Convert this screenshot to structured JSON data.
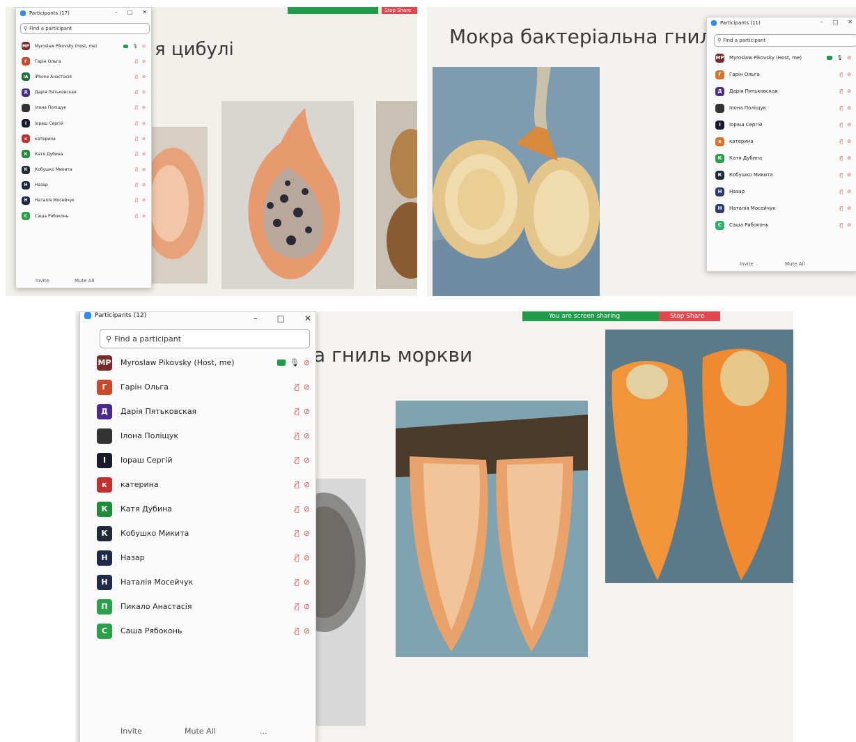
{
  "shot1": {
    "slide_title": "я цибулі",
    "stop_share": "Stop Share",
    "panel": {
      "title": "Participants (17)",
      "search_placeholder": "Find a participant",
      "participants": [
        {
          "initials": "MP",
          "name": "Myroslaw Pikovsky (Host, me)",
          "color": "#7a2a2a"
        },
        {
          "initials": "Г",
          "name": "Гарін Ольга",
          "color": "#c84a2a"
        },
        {
          "initials": "IA",
          "name": "iPhone Анастасія",
          "color": "#1c6b3c"
        },
        {
          "initials": "Д",
          "name": "Дарія Пятьковская",
          "color": "#4a2a8a"
        },
        {
          "initials": "",
          "name": "Ілона Поліщук",
          "color": "#333333"
        },
        {
          "initials": "І",
          "name": "Іораш Сергій",
          "color": "#1a1a2e"
        },
        {
          "initials": "к",
          "name": "катерина",
          "color": "#c23030"
        },
        {
          "initials": "К",
          "name": "Катя Дубина",
          "color": "#1e8c3a"
        },
        {
          "initials": "К",
          "name": "Кобушко Микита",
          "color": "#222a38"
        },
        {
          "initials": "Н",
          "name": "Назар",
          "color": "#1d2a4a"
        },
        {
          "initials": "Н",
          "name": "Наталія Мосейчук",
          "color": "#1d2a4a"
        },
        {
          "initials": "С",
          "name": "Саша Рябоконь",
          "color": "#2aa04a"
        }
      ],
      "invite": "Invite",
      "mute_all": "Mute All"
    }
  },
  "shot2": {
    "slide_title": "Мокра бактеріальна гнил",
    "panel": {
      "title": "Participants (11)",
      "search_placeholder": "Find a participant",
      "participants": [
        {
          "initials": "MP",
          "name": "Myroslaw Pikovsky (Host, me)",
          "color": "#7a2a2a"
        },
        {
          "initials": "Г",
          "name": "Гарін Ольга",
          "color": "#d8732a"
        },
        {
          "initials": "Д",
          "name": "Дарія Пятьковская",
          "color": "#4a2a8a"
        },
        {
          "initials": "",
          "name": "Ілона Поліщук",
          "color": "#333333"
        },
        {
          "initials": "І",
          "name": "Іораш Сергій",
          "color": "#1a1a2e"
        },
        {
          "initials": "к",
          "name": "катерина",
          "color": "#d8732a"
        },
        {
          "initials": "К",
          "name": "Катя Дубина",
          "color": "#2aa04a"
        },
        {
          "initials": "К",
          "name": "Кобушко Микита",
          "color": "#222a38"
        },
        {
          "initials": "Н",
          "name": "Назар",
          "color": "#2a3a6a"
        },
        {
          "initials": "Н",
          "name": "Наталія Мосейчук",
          "color": "#2a3a6a"
        },
        {
          "initials": "С",
          "name": "Саша Рябоконь",
          "color": "#2ab06a"
        }
      ],
      "invite": "Invite",
      "mute_all": "Mute All"
    }
  },
  "shot3": {
    "slide_title": "а гниль моркви",
    "sharing_text": "You are screen sharing",
    "stop_share": "Stop Share",
    "panel": {
      "title": "Participants (12)",
      "search_placeholder": "Find a participant",
      "participants": [
        {
          "initials": "MP",
          "name": "Myroslaw Pikovsky (Host, me)",
          "color": "#7a2a2a"
        },
        {
          "initials": "Г",
          "name": "Гарін Ольга",
          "color": "#c84a2a"
        },
        {
          "initials": "Д",
          "name": "Дарія Пятьковская",
          "color": "#4a2a8a"
        },
        {
          "initials": "",
          "name": "Ілона Поліщук",
          "color": "#333333"
        },
        {
          "initials": "І",
          "name": "Іораш Сергій",
          "color": "#1a1a2e"
        },
        {
          "initials": "к",
          "name": "катерина",
          "color": "#c23030"
        },
        {
          "initials": "К",
          "name": "Катя Дубина",
          "color": "#1e8c3a"
        },
        {
          "initials": "К",
          "name": "Кобушко Микита",
          "color": "#222a38"
        },
        {
          "initials": "Н",
          "name": "Назар",
          "color": "#1d2a4a"
        },
        {
          "initials": "Н",
          "name": "Наталія Мосейчук",
          "color": "#1d2a4a"
        },
        {
          "initials": "П",
          "name": "Пикало Анастасія",
          "color": "#2aa04a"
        },
        {
          "initials": "С",
          "name": "Саша Рябоконь",
          "color": "#2aa04a"
        }
      ],
      "invite": "Invite",
      "mute_all": "Mute All",
      "more": "..."
    }
  }
}
